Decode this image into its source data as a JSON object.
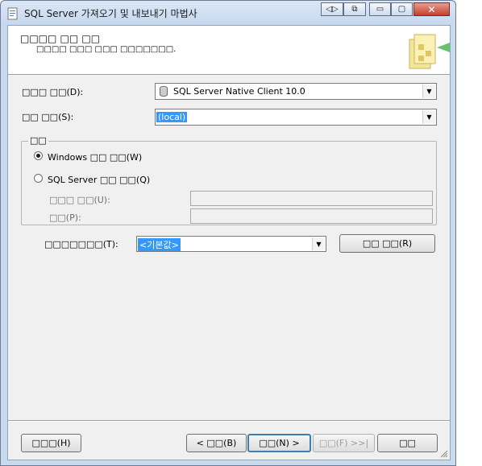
{
  "window": {
    "title": "SQL Server 가져오기 및 내보내기 마법사",
    "controls": {
      "a": "◁▷",
      "b": "⧉",
      "minimize": "▭",
      "maximize": "▢",
      "close": "✕"
    }
  },
  "header": {
    "title": "□□□□ □□ □□",
    "subtitle": "□□□□ □□□ □□□ □□□□□□□."
  },
  "form": {
    "datasource_label": "□□□ □□(D):",
    "datasource_value": "SQL Server Native Client 10.0",
    "server_label": "□□ □□(S):",
    "server_value": "(local)",
    "auth_legend": "□□",
    "windows_auth": "Windows □□ □□(W)",
    "sql_auth": "SQL Server □□ □□(Q)",
    "username_label": "□□□ □□(U):",
    "password_label": "□□(P):",
    "database_label": "□□□□□□□(T):",
    "database_value": "<기본값>",
    "refresh_button": "□□ □□(R)"
  },
  "footer": {
    "help": "□□□(H)",
    "back": "< □□(B)",
    "next": "□□(N) >",
    "finish": "□□(F) >>|",
    "cancel": "□□"
  }
}
